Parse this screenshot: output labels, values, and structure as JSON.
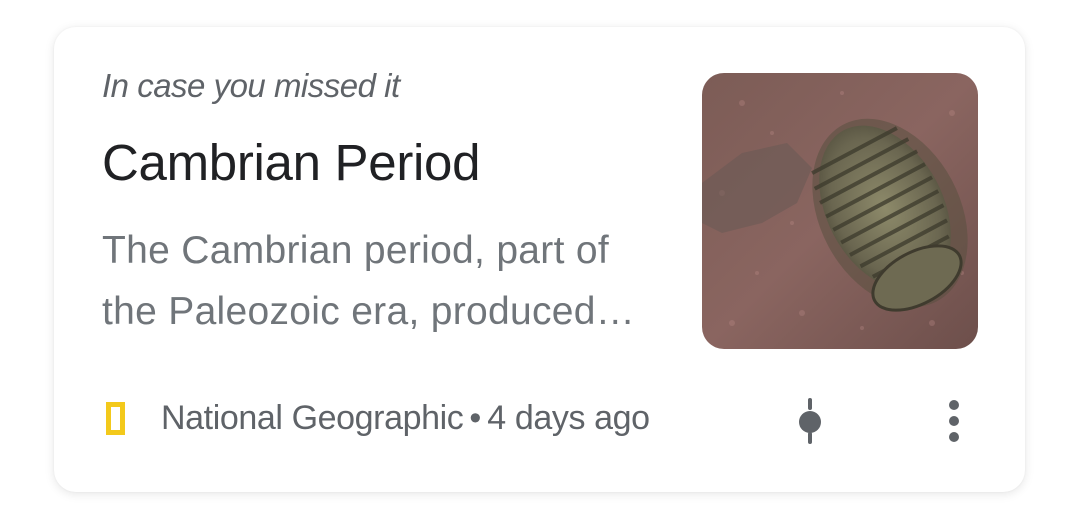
{
  "card": {
    "eyebrow": "In case you missed it",
    "title": "Cambrian Period",
    "snippet_line1": "The Cambrian period, part of",
    "snippet_line2": "the Paleozoic era, produced…",
    "source": "National Geographic",
    "separator": "•",
    "timestamp": "4 days ago",
    "thumbnail": "trilobite-fossil-image"
  },
  "icons": {
    "source_logo": "national-geographic-logo",
    "follow": "follow-topic-icon",
    "more": "more-vert-icon"
  },
  "colors": {
    "logo_yellow": "#f3c91b",
    "icon_gray": "#5f6368",
    "title": "#202124",
    "snippet": "#70757a"
  }
}
